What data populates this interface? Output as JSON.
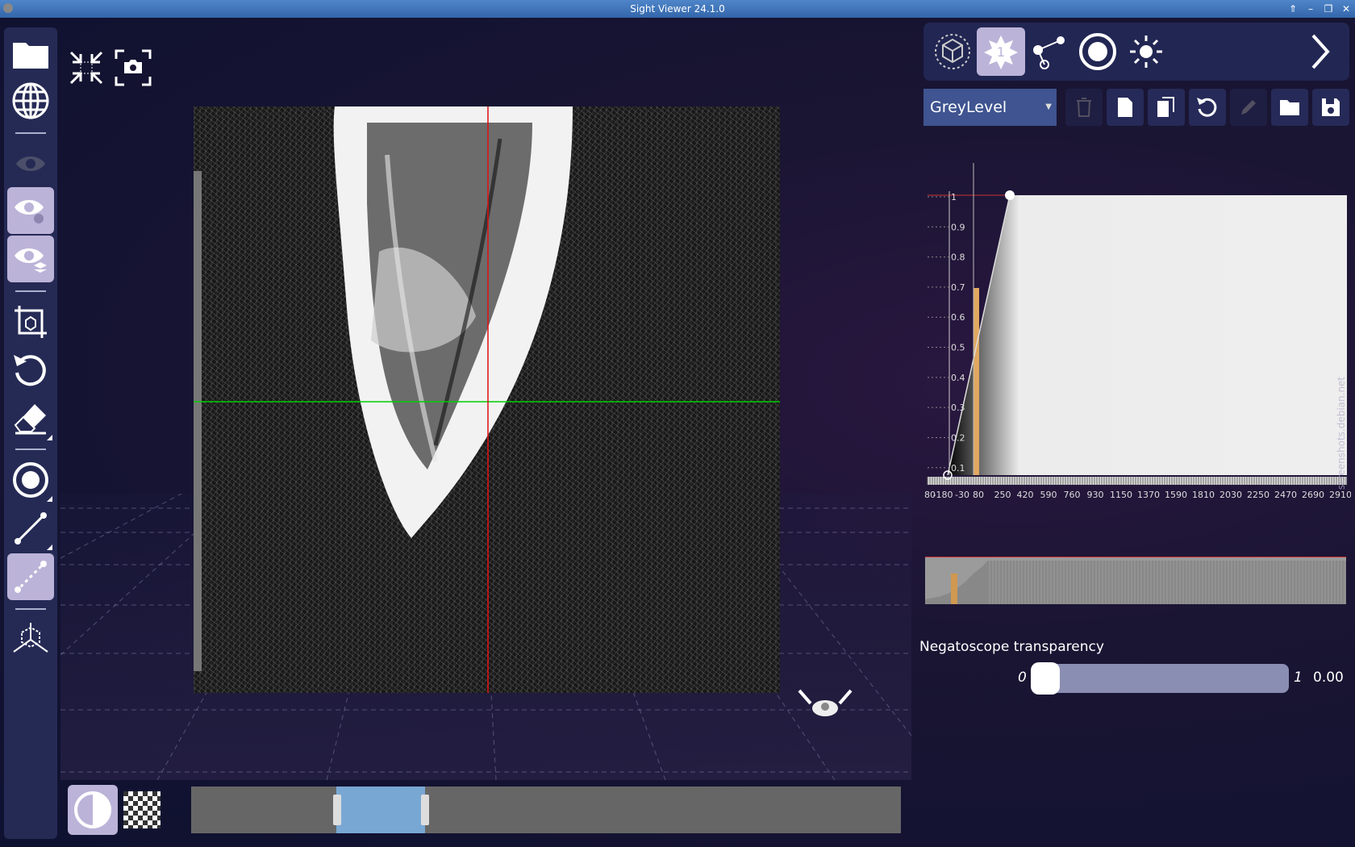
{
  "window": {
    "title": "Sight Viewer 24.1.0"
  },
  "left_toolbar": {
    "items": [
      {
        "name": "open-folder"
      },
      {
        "name": "globe"
      },
      {
        "name": "eye-disabled"
      },
      {
        "name": "eye-negato"
      },
      {
        "name": "eye-layers"
      },
      {
        "name": "crop-3d"
      },
      {
        "name": "undo"
      },
      {
        "name": "eraser"
      },
      {
        "name": "target"
      },
      {
        "name": "distance"
      },
      {
        "name": "distance-dashed"
      },
      {
        "name": "axes-3d"
      }
    ]
  },
  "right_panel": {
    "tabs": [
      "volume-render",
      "tf-splat",
      "landmarks",
      "target",
      "brightness"
    ],
    "active_tab_badge": "1",
    "tf_preset": {
      "selected": "GreyLevel"
    },
    "y_ticks": [
      "1",
      "0.9",
      "0.8",
      "0.7",
      "0.6",
      "0.5",
      "0.4",
      "0.3",
      "0.2",
      "0.1"
    ],
    "x_ticks": [
      "80",
      "-180",
      "-30",
      "80",
      "250",
      "420",
      "590",
      "760",
      "930",
      "1150",
      "1370",
      "1590",
      "1810",
      "2030",
      "2250",
      "2470",
      "2690",
      "2910"
    ],
    "watermark": "screenshots.debian.net",
    "negatoscope": {
      "label": "Negatoscope transparency",
      "min": "0",
      "max": "1",
      "value": "0.00",
      "position": 0.0
    }
  },
  "timeline": {
    "range_start": 0.22,
    "range_end": 0.33
  },
  "colors": {
    "accent_active": "#bcb3d8",
    "toolbar_bg": "#252a55",
    "crosshair_h": "#00d000",
    "crosshair_v": "#e01010"
  }
}
